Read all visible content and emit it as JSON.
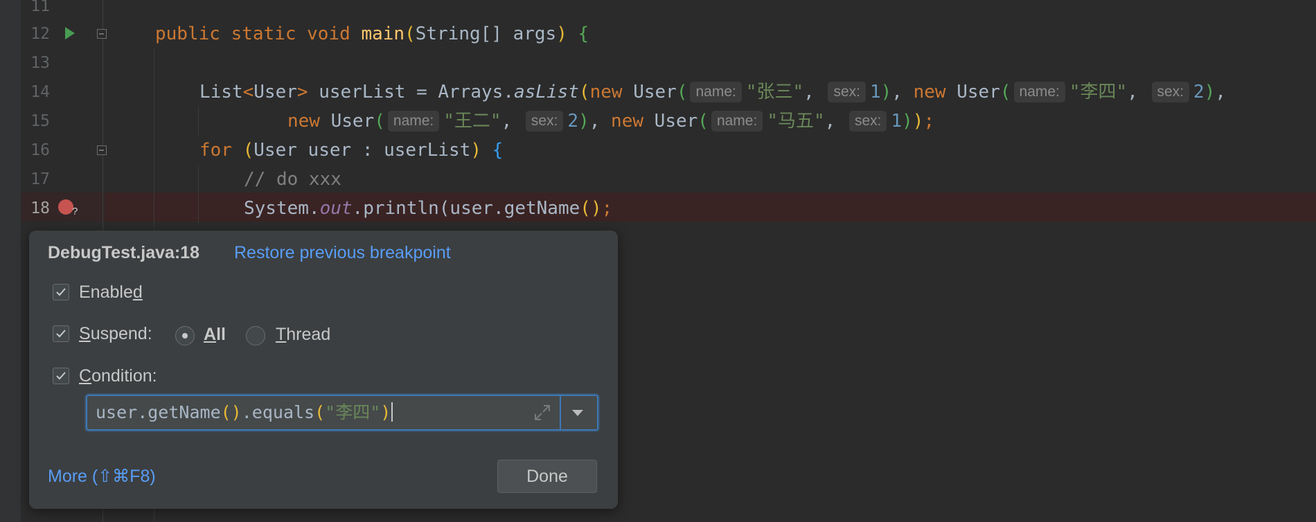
{
  "editor": {
    "line_numbers": [
      "11",
      "12",
      "13",
      "14",
      "15",
      "16",
      "17",
      "18"
    ],
    "code": {
      "l12": {
        "kw_public": "public",
        "kw_static": "static",
        "kw_void": "void",
        "fn": "main",
        "sig": "String[] args",
        "brace": "{"
      },
      "l14": {
        "prefix": "List",
        "tparam": "User",
        "suffix": " userList = Arrays.",
        "method": "asList",
        "kw_new": "new",
        "cls": "User",
        "hint_name": "name:",
        "hint_sex": "sex:",
        "s1": "\"张三\"",
        "n1": "1",
        "s2": "\"李四\"",
        "n2": "2"
      },
      "l15": {
        "kw_new": "new",
        "cls": "User",
        "hint_name": "name:",
        "hint_sex": "sex:",
        "s3": "\"王二\"",
        "n3": "2",
        "s4": "\"马五\"",
        "n4": "1"
      },
      "l16": {
        "kw_for": "for",
        "body": "User user : userList",
        "brace": "{"
      },
      "l17": {
        "comment": "// do xxx"
      },
      "l18": {
        "obj": "System.",
        "field": "out",
        "call": ".println(user.getName",
        "end": ";"
      }
    }
  },
  "popup": {
    "title": "DebugTest.java:18",
    "restore_link": "Restore previous breakpoint",
    "enabled": {
      "pre": "Enable",
      "u": "d",
      "post": "",
      "checked": true
    },
    "suspend": {
      "pre": "",
      "u": "S",
      "post": "uspend:",
      "checked": true
    },
    "radio_all": {
      "pre": "",
      "u": "A",
      "post": "ll",
      "selected": true
    },
    "radio_thread": {
      "pre": "",
      "u": "T",
      "post": "hread",
      "selected": false
    },
    "condition": {
      "pre": "",
      "u": "C",
      "post": "ondition:",
      "checked": true
    },
    "condition_value": {
      "head": "user.getName",
      "call_rest": ".equals",
      "str": "\"李四\""
    },
    "more_link": "More (⇧⌘F8)",
    "done_button": "Done"
  },
  "colors": {
    "breakpoint": "#c75450",
    "accent_link": "#589df6",
    "focus_border": "#3d79b7"
  }
}
